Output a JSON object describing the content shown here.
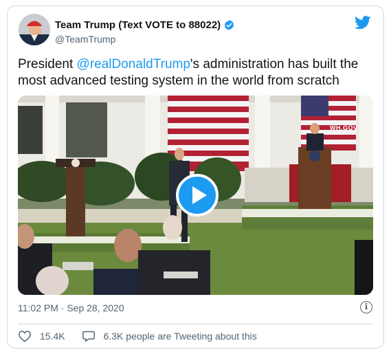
{
  "author": {
    "name": "Team Trump (Text VOTE to 88022)",
    "handle": "@TeamTrump"
  },
  "tweet": {
    "text_before": "President ",
    "mention": "@realDonaldTrump",
    "text_after": "'s administration has built the most advanced testing system in the world from scratch"
  },
  "media": {
    "type": "video",
    "watermark": "WH.GOV"
  },
  "timestamp": "11:02 PM · Sep 28, 2020",
  "actions": {
    "likes": "15.4K",
    "conversation": "6.3K people are Tweeting about this"
  },
  "colors": {
    "accent": "#1d9bf0",
    "text": "#0f1419",
    "muted": "#536471",
    "border": "#cfd9de"
  },
  "icons": [
    "verified-badge-icon",
    "twitter-bird-icon",
    "play-icon",
    "info-icon",
    "heart-icon",
    "speech-bubble-icon"
  ]
}
